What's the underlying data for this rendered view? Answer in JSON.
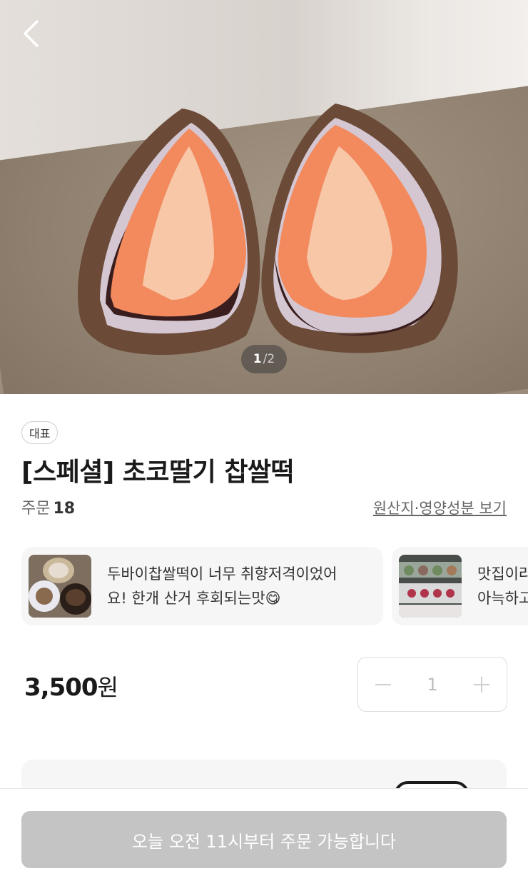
{
  "hero": {
    "page_current": "1",
    "page_total": "/2"
  },
  "product": {
    "badge": "대표",
    "title": "[스페셜] 초코딸기 찹쌀떡",
    "orders_label": "주문",
    "orders_count": "18",
    "origin_link": "원산지·영양성분 보기"
  },
  "reviews": [
    {
      "line1": "두바이찹쌀떡이 너무 취향저격이었어",
      "line2": "요! 한개 산거 후회되는맛😋"
    },
    {
      "line1": "맛집이라",
      "line2": "아늑하고"
    }
  ],
  "price": {
    "amount": "3,500",
    "unit": "원"
  },
  "quantity": {
    "value": "1"
  },
  "order_button": {
    "label": "오늘 오전 11시부터 주문 가능합니다"
  },
  "colors": {
    "button_disabled": "#c4c4c4",
    "card_bg": "#f6f6f6"
  }
}
